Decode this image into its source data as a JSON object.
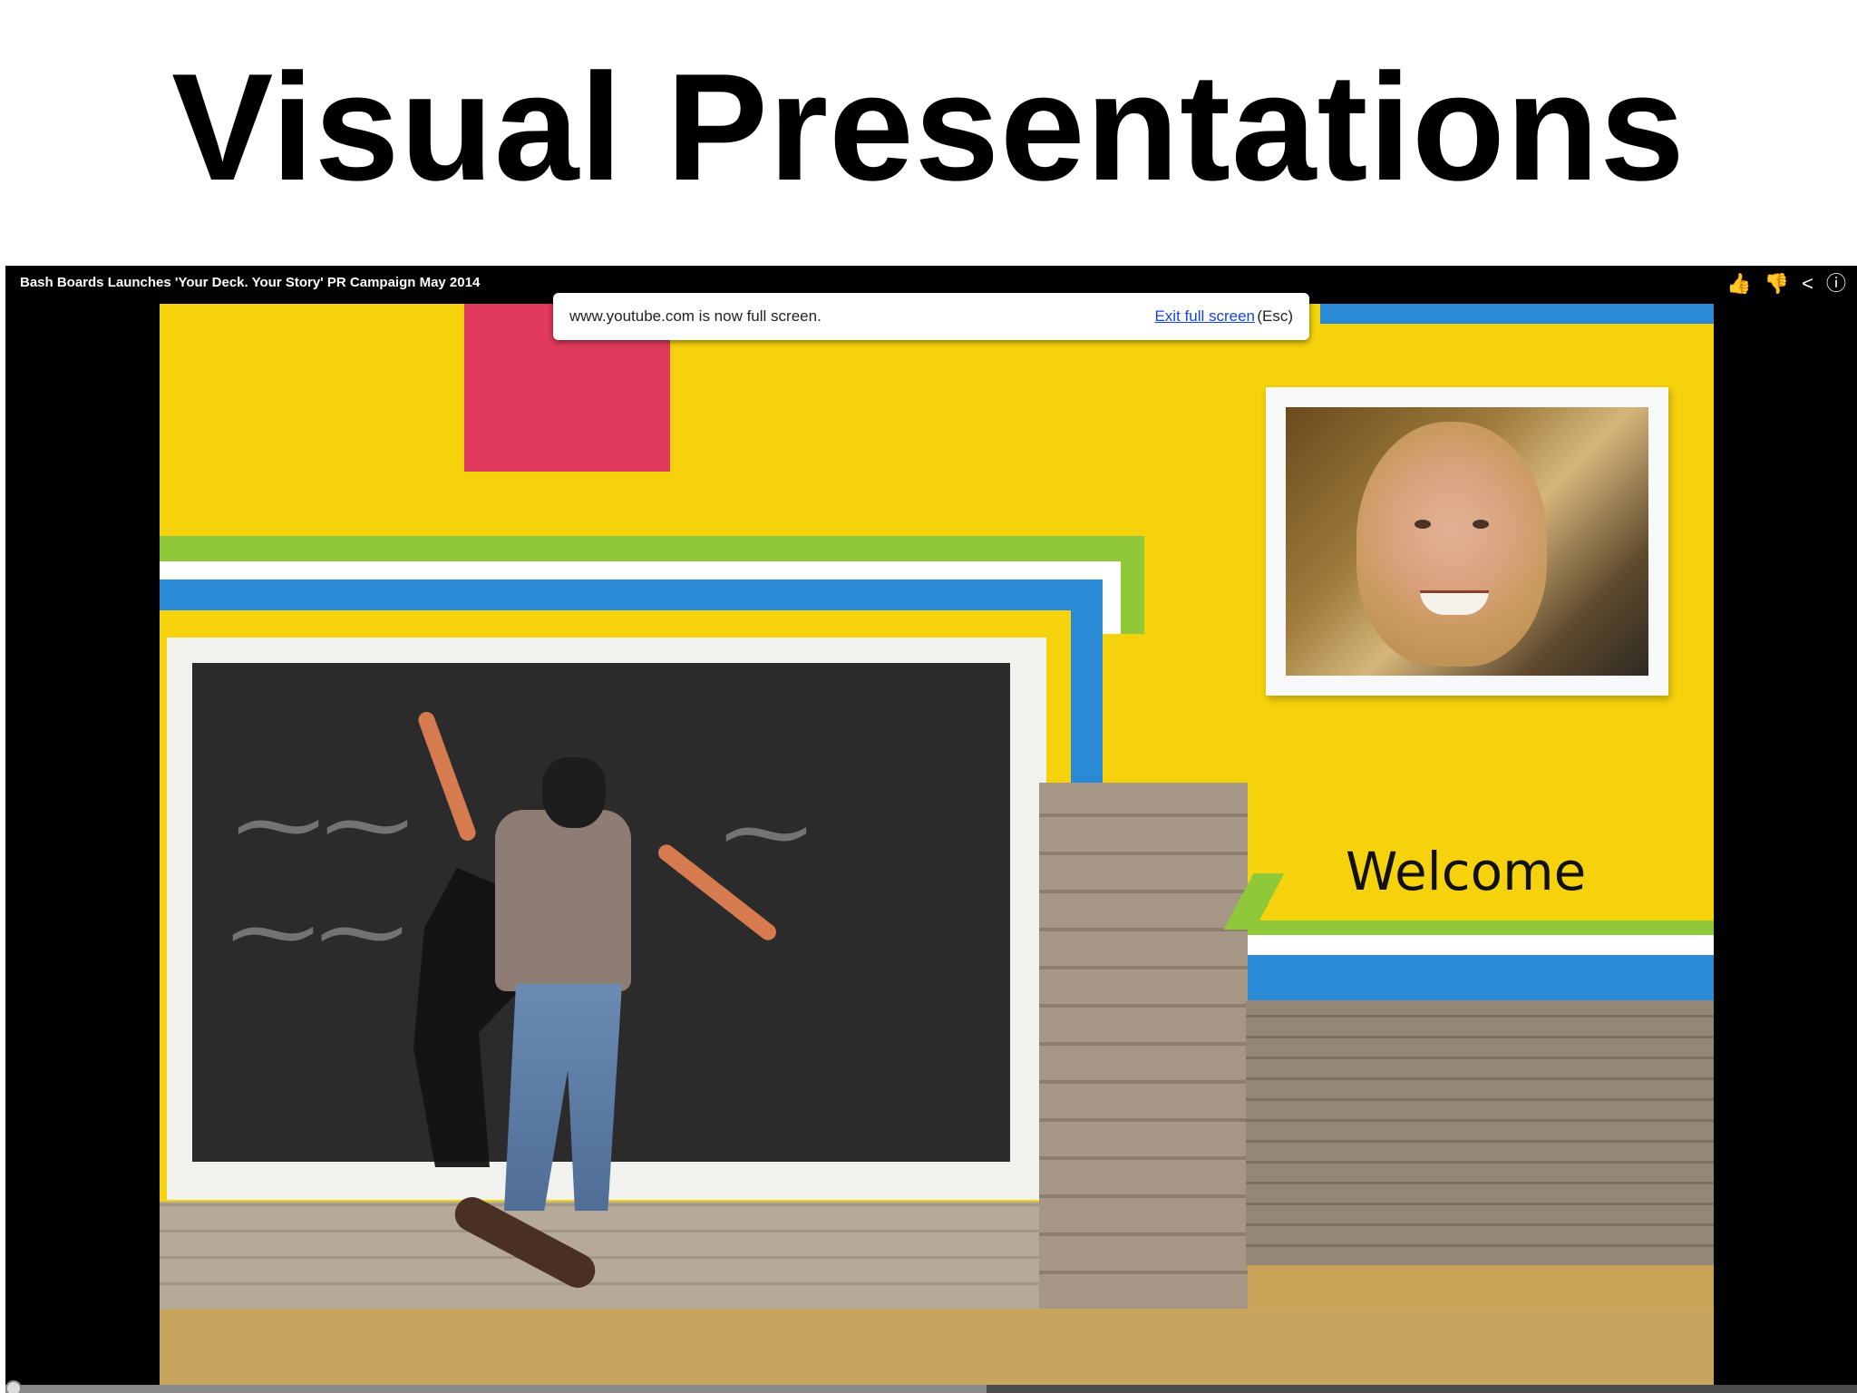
{
  "slide": {
    "title": "Visual Presentations"
  },
  "player": {
    "video_title": "Bash Boards Launches 'Your Deck. Your Story' PR Campaign May 2014",
    "toast": {
      "message": "www.youtube.com is now full screen.",
      "exit_link": "Exit full screen",
      "hint": "(Esc)"
    },
    "icons": [
      "thumbs-up-icon",
      "thumbs-down-icon",
      "share-icon",
      "info-icon"
    ],
    "progress_fraction": 0.53
  },
  "video_frame": {
    "welcome_text": "Welcome"
  }
}
